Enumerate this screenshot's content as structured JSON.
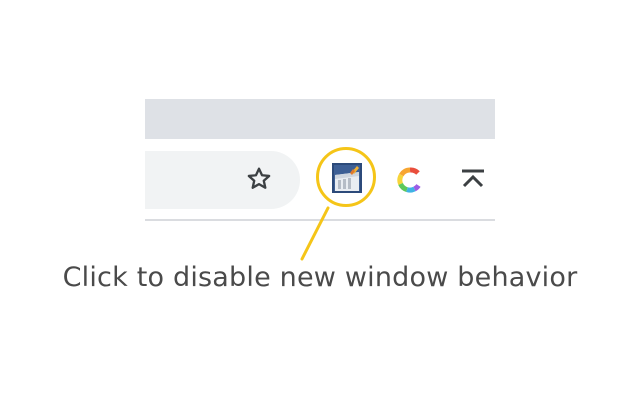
{
  "caption": {
    "text": "Click to disable new window behavior"
  },
  "toolbar": {
    "icons": {
      "star": "star-outline-icon",
      "extension": "new-window-extension-icon",
      "c_extension": "rainbow-c-icon",
      "scroll_top": "arrow-to-top-icon"
    }
  },
  "colors": {
    "highlight": "#f5c518",
    "tabstrip": "#dee1e6",
    "omnibox": "#f1f3f4",
    "caption": "#4a4a4a"
  }
}
